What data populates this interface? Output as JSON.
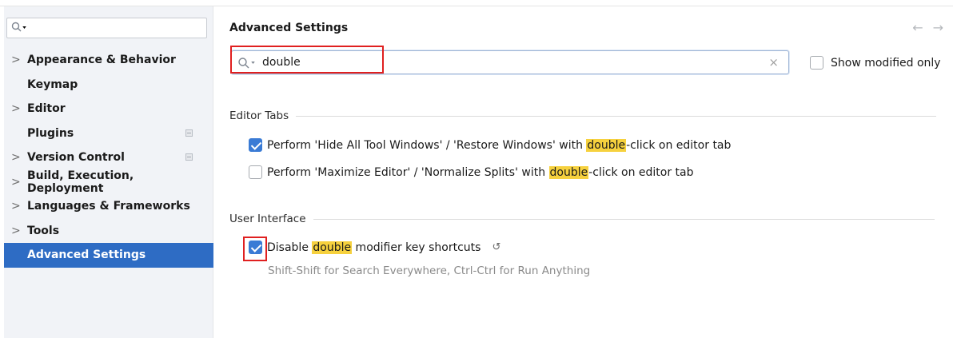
{
  "sidebar": {
    "search": {
      "placeholder": ""
    },
    "items": [
      {
        "label": "Appearance & Behavior",
        "expandable": true,
        "modified": false,
        "selected": false
      },
      {
        "label": "Keymap",
        "expandable": false,
        "modified": false,
        "selected": false
      },
      {
        "label": "Editor",
        "expandable": true,
        "modified": false,
        "selected": false
      },
      {
        "label": "Plugins",
        "expandable": false,
        "modified": true,
        "selected": false
      },
      {
        "label": "Version Control",
        "expandable": true,
        "modified": true,
        "selected": false
      },
      {
        "label": "Build, Execution, Deployment",
        "expandable": true,
        "modified": false,
        "selected": false
      },
      {
        "label": "Languages & Frameworks",
        "expandable": true,
        "modified": false,
        "selected": false
      },
      {
        "label": "Tools",
        "expandable": true,
        "modified": false,
        "selected": false
      },
      {
        "label": "Advanced Settings",
        "expandable": false,
        "modified": false,
        "selected": true
      }
    ],
    "chevron": ">"
  },
  "main": {
    "title": "Advanced Settings",
    "back_arrow": "←",
    "forward_arrow": "→",
    "search": {
      "value": "double",
      "clear": "×"
    },
    "show_modified": {
      "label": "Show modified only",
      "checked": false
    },
    "sections": [
      {
        "heading": "Editor Tabs",
        "options": [
          {
            "checked": true,
            "before": "Perform 'Hide All Tool Windows' / 'Restore Windows' with ",
            "match": "double",
            "after": "-click on editor tab"
          },
          {
            "checked": false,
            "before": "Perform 'Maximize Editor' / 'Normalize Splits' with ",
            "match": "double",
            "after": "-click on editor tab"
          }
        ]
      },
      {
        "heading": "User Interface",
        "options": [
          {
            "checked": true,
            "before": "Disable ",
            "match": "double",
            "after": " modifier key shortcuts",
            "revert": "↺",
            "description": "Shift-Shift for Search Everywhere, Ctrl-Ctrl for Run Anything"
          }
        ]
      }
    ]
  },
  "colors": {
    "accent": "#2e6cc4",
    "checkbox": "#3a7bd5",
    "highlight": "#f6d13e",
    "annotation": "#e02020"
  }
}
